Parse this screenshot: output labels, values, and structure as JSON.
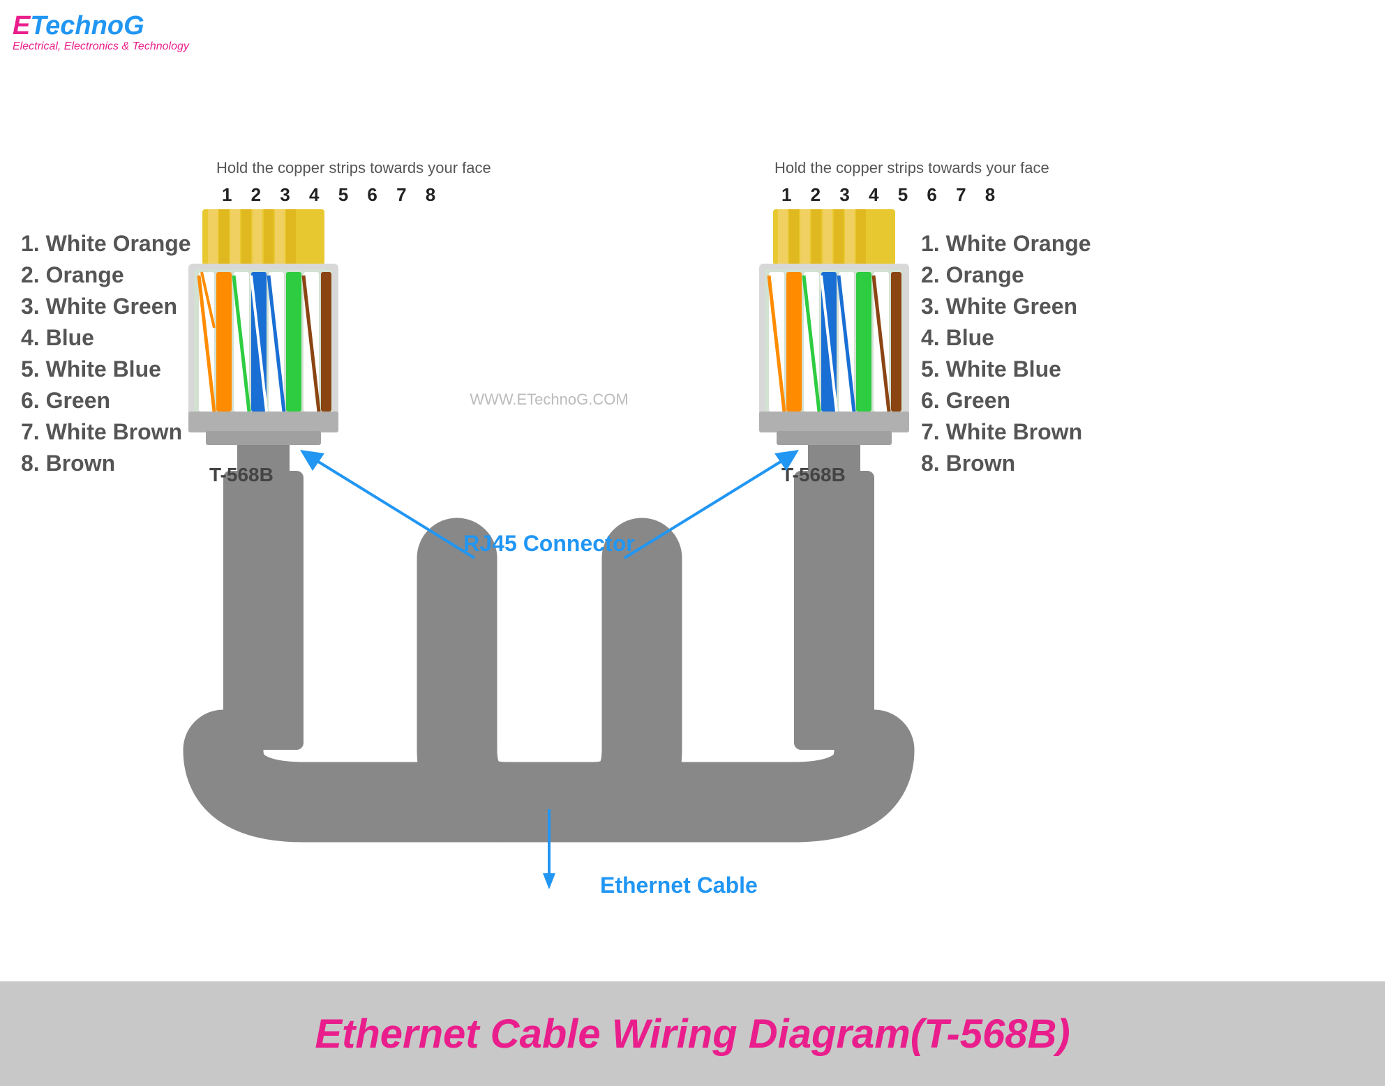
{
  "logo": {
    "e": "E",
    "technog": "TechnoG",
    "subtitle": "Electrical, Electronics & Technology"
  },
  "left_connector": {
    "copper_label": "Hold the copper strips towards your face",
    "pin_numbers": "1 2 3 4 5 6 7 8",
    "standard": "T-568B"
  },
  "right_connector": {
    "copper_label": "Hold the copper strips towards your face",
    "pin_numbers": "1 2 3 4 5 6 7 8",
    "standard": "T-568B"
  },
  "wire_labels_left": [
    "1. White Orange",
    "2. Orange",
    "3. White Green",
    "4. Blue",
    "5. White Blue",
    "6. Green",
    "7. White Brown",
    "8. Brown"
  ],
  "wire_labels_right": [
    "1. White Orange",
    "2. Orange",
    "3. White Green",
    "4. Blue",
    "5. White Blue",
    "6. Green",
    "7. White Brown",
    "8. Brown"
  ],
  "center_labels": {
    "rj45": "RJ45 Connector",
    "ethernet": "Ethernet Cable",
    "watermark": "WWW.ETechnoG.COM"
  },
  "bottom": {
    "title": "Ethernet Cable Wiring Diagram(T-568B)"
  }
}
